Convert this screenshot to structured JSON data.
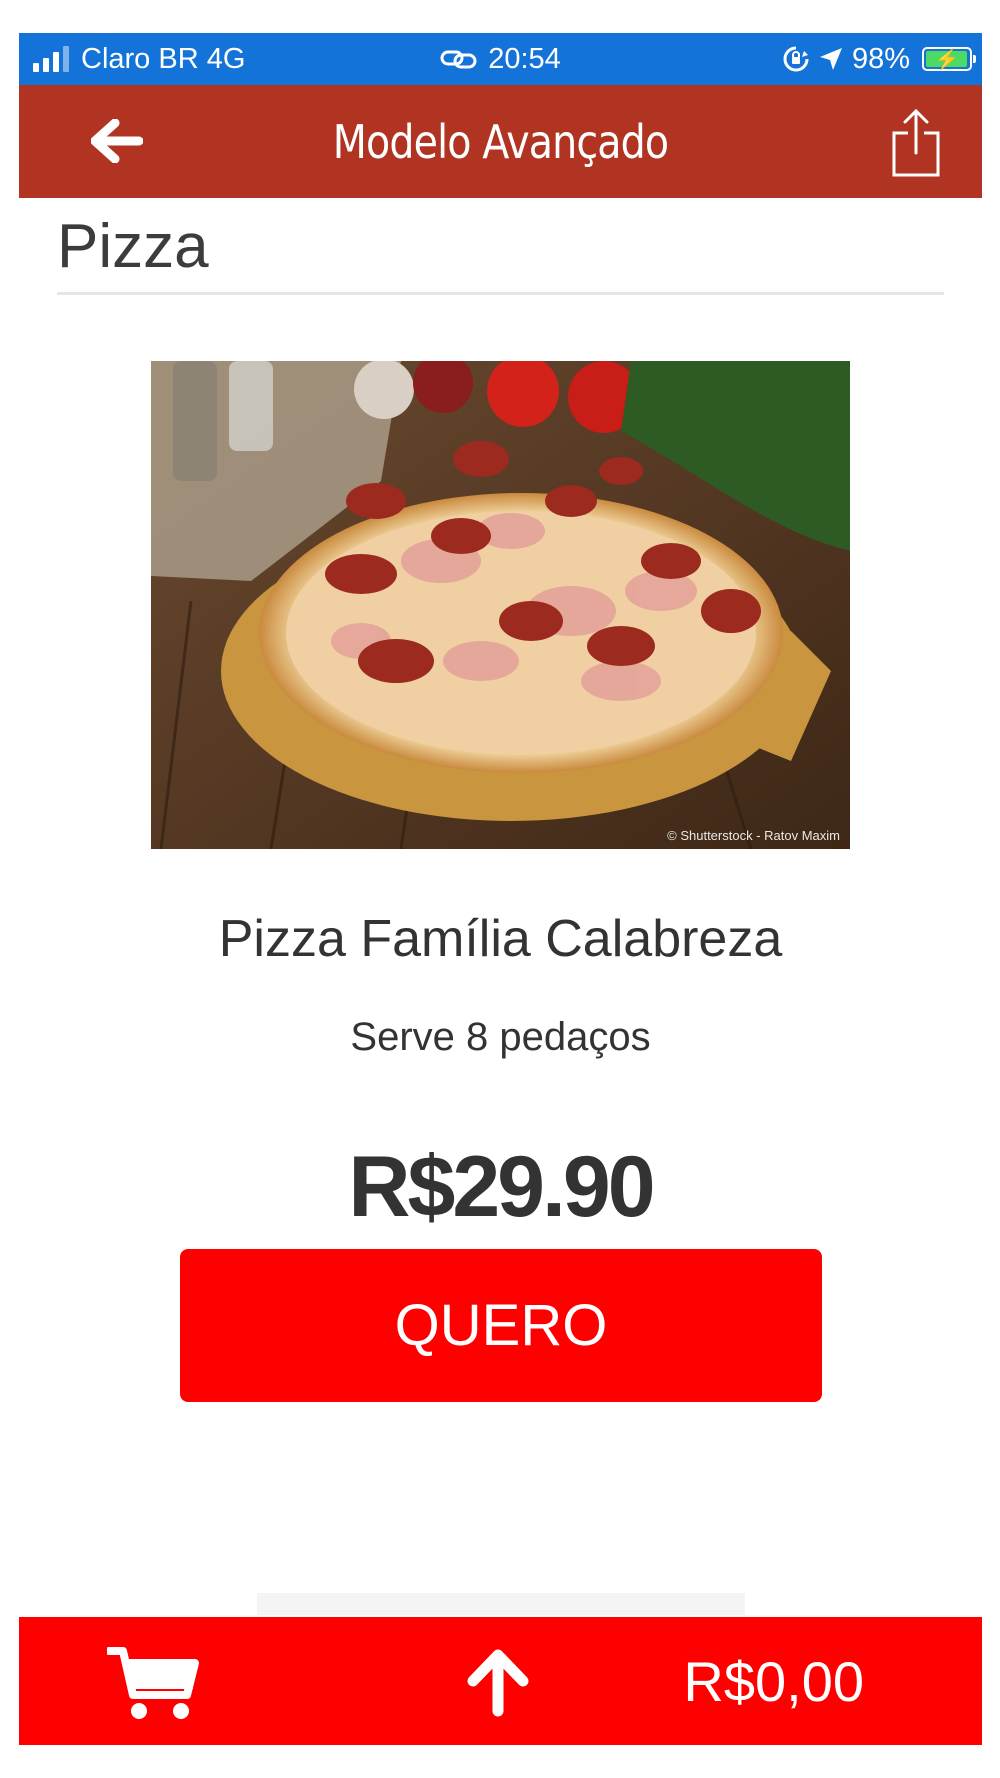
{
  "status_bar": {
    "carrier": "Claro BR 4G",
    "time": "20:54",
    "battery": "98%",
    "battery_level": 0.98,
    "icons": [
      "signal-icon",
      "link-icon",
      "orientation-lock-icon",
      "location-arrow-icon",
      "battery-charging-icon"
    ]
  },
  "nav": {
    "title": "Modelo Avançado",
    "back_icon": "arrow-left-icon",
    "share_icon": "share-icon",
    "color": "#b03421"
  },
  "section": {
    "title": "Pizza"
  },
  "product": {
    "image_alt": "pizza-photo",
    "photo_credit": "© Shutterstock - Ratov Maxim",
    "name": "Pizza Família Calabreza",
    "description": "Serve 8 pedaços",
    "price": "R$29.90",
    "button_label": "QUERO",
    "button_color": "#ff0000"
  },
  "bottom_bar": {
    "cart_icon": "cart-icon",
    "up_icon": "arrow-up-icon",
    "total": "R$0,00",
    "color": "#ff0000"
  },
  "colors": {
    "status_bar": "#1473d8",
    "text_primary": "#333333"
  }
}
